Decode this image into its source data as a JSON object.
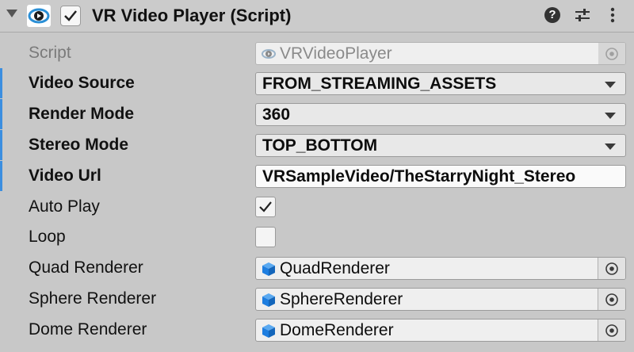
{
  "header": {
    "title": "VR Video Player (Script)",
    "enabled": true,
    "icons": [
      "foldout-arrow-icon",
      "script-icon",
      "help-icon",
      "preset-icon",
      "kebab-menu-icon"
    ]
  },
  "fields": {
    "script": {
      "label": "Script",
      "value": "VRVideoPlayer"
    },
    "video_source": {
      "label": "Video Source",
      "value": "FROM_STREAMING_ASSETS"
    },
    "render_mode": {
      "label": "Render Mode",
      "value": "360"
    },
    "stereo_mode": {
      "label": "Stereo Mode",
      "value": "TOP_BOTTOM"
    },
    "video_url": {
      "label": "Video Url",
      "value": "VRSampleVideo/TheStarryNight_Stereo"
    },
    "auto_play": {
      "label": "Auto Play",
      "checked": true
    },
    "loop": {
      "label": "Loop",
      "checked": false
    },
    "quad_renderer": {
      "label": "Quad Renderer",
      "value": "QuadRenderer"
    },
    "sphere_renderer": {
      "label": "Sphere Renderer",
      "value": "SphereRenderer"
    },
    "dome_renderer": {
      "label": "Dome Renderer",
      "value": "DomeRenderer"
    }
  },
  "colors": {
    "modified_accent": "#3b8ee0",
    "gameobject_icon": "#1e7ee0",
    "background": "#c8c8c8"
  }
}
